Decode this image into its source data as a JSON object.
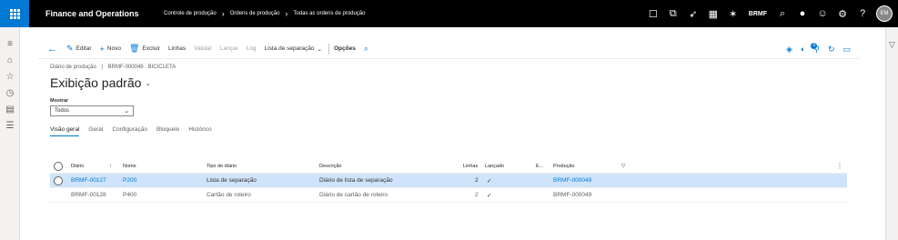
{
  "topbar": {
    "app_title": "Finance and Operations",
    "breadcrumb": [
      "Controle de produção",
      "Ordens de produção",
      "Todas as ordens de produção"
    ],
    "company": "BRMF",
    "avatar_initials": "EM",
    "notification_count": "0"
  },
  "actionpane": {
    "edit": "Editar",
    "new": "Novo",
    "delete": "Excluir",
    "lines": "Linhas",
    "validate": "Validar",
    "post": "Lançar",
    "log": "Log",
    "picking_list": "Lista de separação",
    "options": "Opções",
    "attach_count": "0"
  },
  "page": {
    "subhead_left": "Diário de produção",
    "subhead_sep": "|",
    "subhead_right": "BRMF-000049 : BICICLETA",
    "title": "Exibição padrão"
  },
  "filter": {
    "label": "Mostrar",
    "value": "Todos"
  },
  "tabs": [
    "Visão geral",
    "Geral",
    "Configuração",
    "Bloqueio",
    "Histórico"
  ],
  "grid": {
    "columns": {
      "journal": "Diário",
      "name": "Nome",
      "type": "Tipo de diário",
      "description": "Descrição",
      "lines": "Linhas",
      "posted": "Lançado",
      "e": "E...",
      "production": "Produção"
    },
    "rows": [
      {
        "journal": "BRMF-00127",
        "name": "P200",
        "type": "Lista de separação",
        "description": "Diário de lista de separação",
        "lines": "2",
        "posted": "✓",
        "production": "BRMF-000049",
        "selected": true
      },
      {
        "journal": "BRMF-00128",
        "name": "P400",
        "type": "Cartão de roteiro",
        "description": "Diário de cartão de roteiro",
        "lines": "2",
        "posted": "✓",
        "production": "BRMF-000049",
        "selected": false
      }
    ]
  }
}
